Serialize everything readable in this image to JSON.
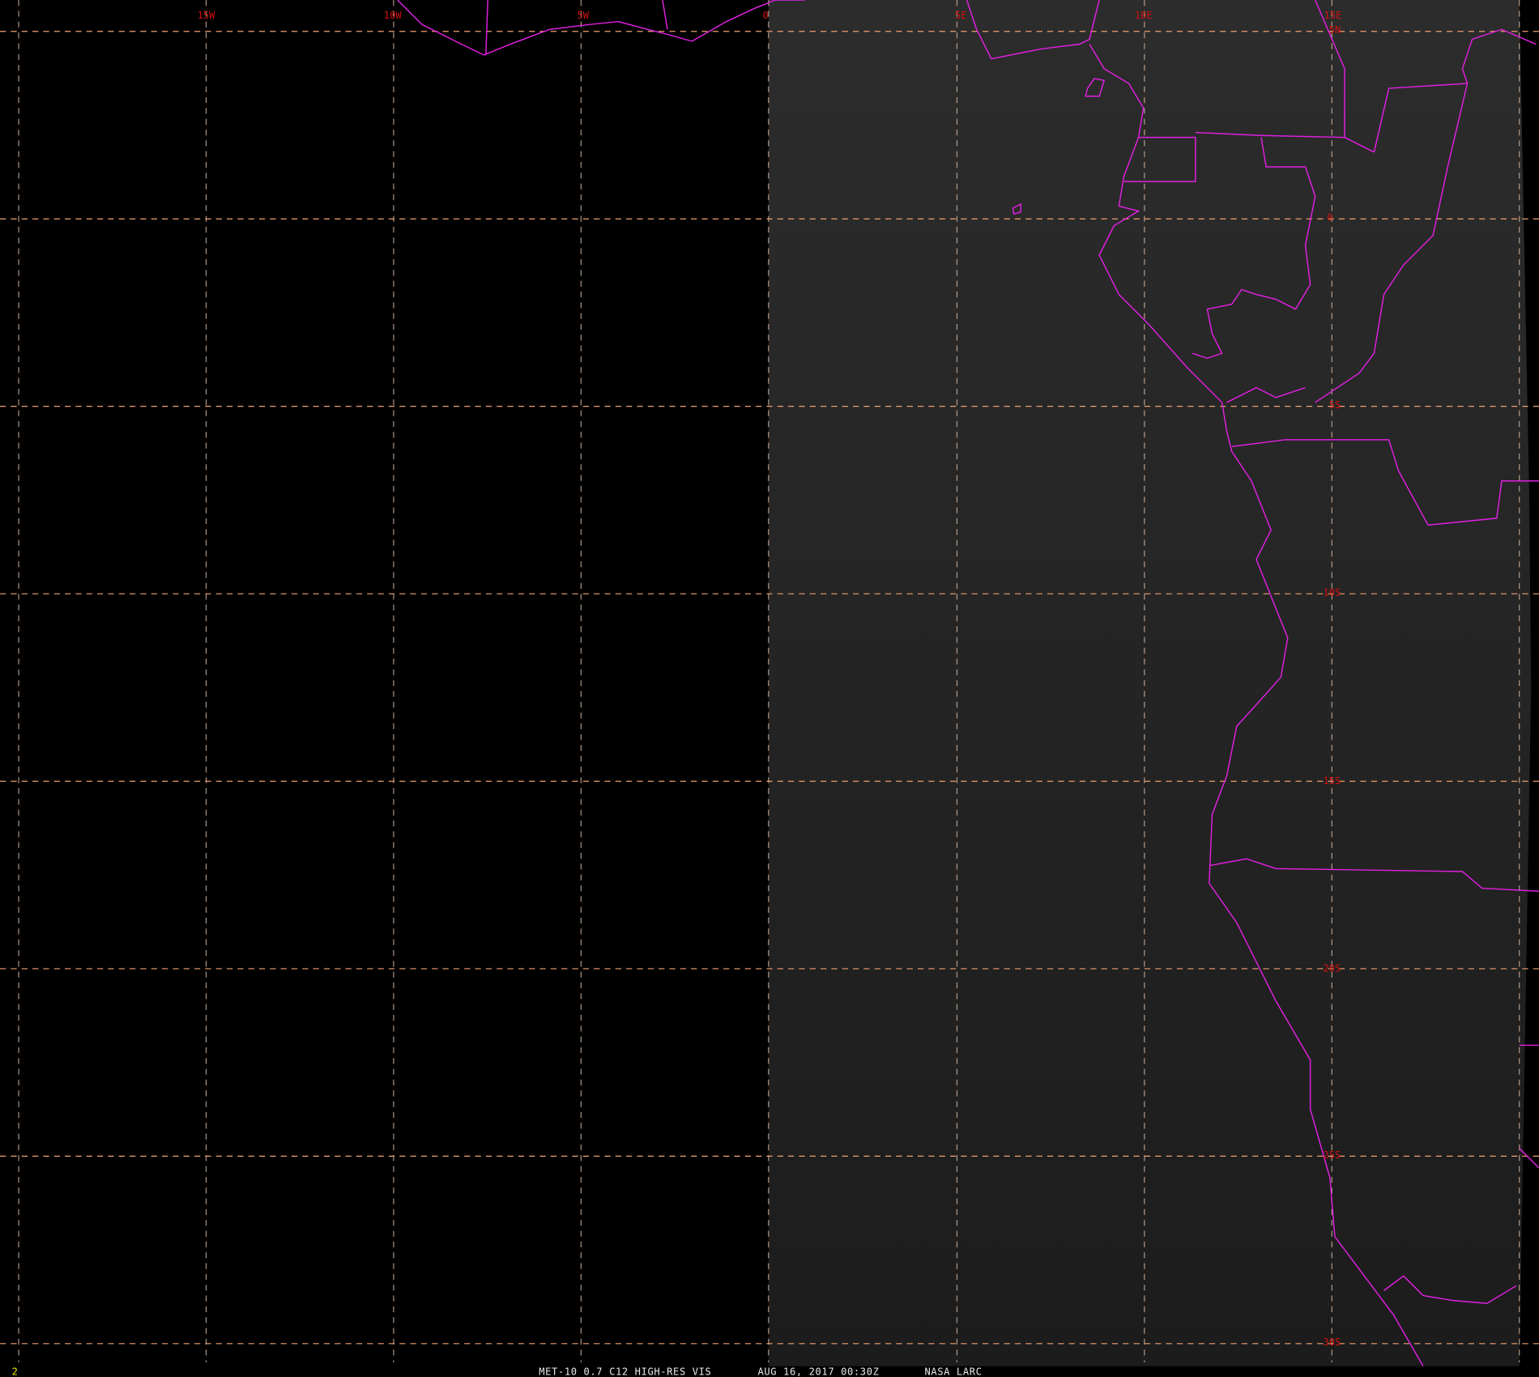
{
  "frame_number": "2",
  "caption": {
    "product": "MET-10 0.7 C12 HIGH-RES VIS",
    "datetime": "AUG 16, 2017 00:30Z",
    "source": "NASA LARC"
  },
  "longitude_labels": [
    "15W",
    "10W",
    "5W",
    "0",
    "5E",
    "10E",
    "15E"
  ],
  "latitude_labels": [
    "5N",
    "0",
    "5S",
    "10S",
    "15S",
    "20S",
    "25S",
    "30S"
  ],
  "colors": {
    "coastline": "#e020e0",
    "gridline": "#f0a070",
    "grid_label": "#d01010",
    "frame_number": "#e8e800"
  }
}
